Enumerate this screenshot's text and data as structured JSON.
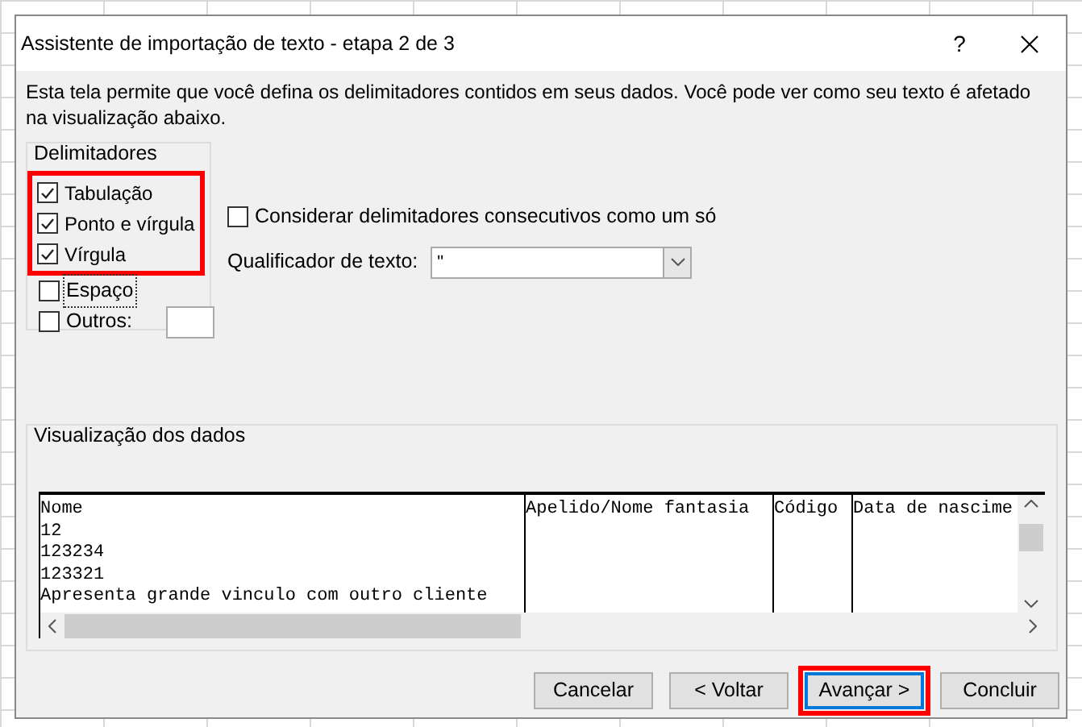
{
  "window": {
    "title": "Assistente de importação de texto - etapa 2 de 3",
    "help": "?"
  },
  "description": "Esta tela permite que você defina os delimitadores contidos em seus dados. Você pode ver como seu texto é afetado na visualização abaixo.",
  "delimiters": {
    "title": "Delimitadores",
    "items": [
      {
        "label": "Tabulação",
        "checked": true,
        "highlighted": true,
        "focused": false
      },
      {
        "label": "Ponto e vírgula",
        "checked": true,
        "highlighted": true,
        "focused": false
      },
      {
        "label": "Vírgula",
        "checked": true,
        "highlighted": true,
        "focused": false
      },
      {
        "label": "Espaço",
        "checked": false,
        "highlighted": false,
        "focused": true
      },
      {
        "label": "Outros:",
        "checked": false,
        "highlighted": false,
        "focused": false,
        "kind": "other"
      }
    ]
  },
  "consecutive": {
    "label": "Considerar delimitadores consecutivos como um só",
    "checked": false
  },
  "qualifier": {
    "label": "Qualificador de texto:",
    "value": "\""
  },
  "preview": {
    "title": "Visualização dos dados",
    "columns": [
      {
        "header": "Nome",
        "cells": [
          "12",
          "123234",
          "123321",
          "Apresenta grande vinculo com outro cliente"
        ]
      },
      {
        "header": "Apelido/Nome fantasia"
      },
      {
        "header": "Código"
      },
      {
        "header": "Data de nascime"
      }
    ]
  },
  "buttons": [
    {
      "label": "Cancelar",
      "default": false,
      "highlighted": false
    },
    {
      "label": "< Voltar",
      "default": false,
      "highlighted": false
    },
    {
      "label": "Avançar >",
      "default": true,
      "highlighted": true
    },
    {
      "label": "Concluir",
      "default": false,
      "highlighted": false
    }
  ]
}
